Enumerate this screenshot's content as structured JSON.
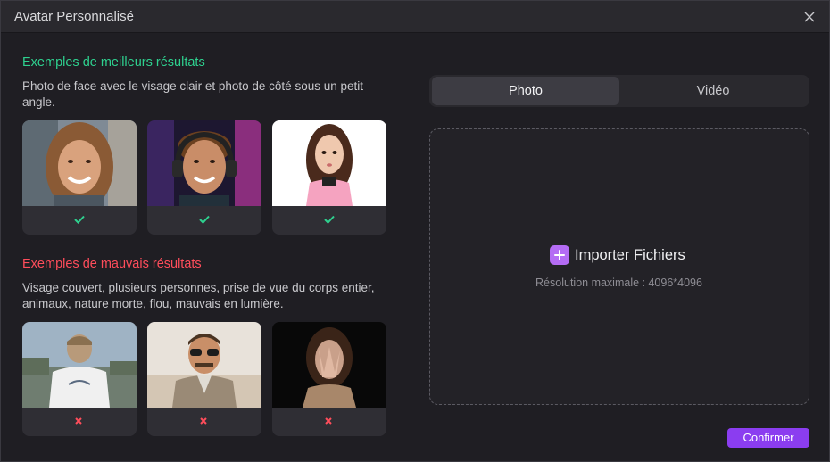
{
  "window": {
    "title": "Avatar Personnalisé"
  },
  "good": {
    "title": "Exemples de meilleurs résultats",
    "description": "Photo de face avec le visage clair et photo de côté sous un petit angle.",
    "examples": [
      {
        "image": "smiling-woman-portrait",
        "status_icon": "check-icon"
      },
      {
        "image": "young-man-headset",
        "status_icon": "check-icon"
      },
      {
        "image": "girl-pink-hoodie",
        "status_icon": "check-icon"
      }
    ]
  },
  "bad": {
    "title": "Exemples de mauvais résultats",
    "description": "Visage couvert, plusieurs personnes, prise de vue du corps entier, animaux, nature morte, flou, mauvais en lumière.",
    "examples": [
      {
        "image": "man-from-behind",
        "status_icon": "x-icon"
      },
      {
        "image": "man-sunglasses",
        "status_icon": "x-icon"
      },
      {
        "image": "woman-hand-covering-face",
        "status_icon": "x-icon"
      }
    ]
  },
  "tabs": [
    {
      "label": "Photo",
      "selected": true
    },
    {
      "label": "Vidéo",
      "selected": false
    }
  ],
  "upload": {
    "label": "Importer Fichiers",
    "hint": "Résolution maximale : 4096*4096"
  },
  "confirm_label": "Confirmer",
  "colors": {
    "good": "#2ed18f",
    "bad": "#ff4d5b",
    "accent": "#8b3df0",
    "plus": "#b46cf4"
  }
}
